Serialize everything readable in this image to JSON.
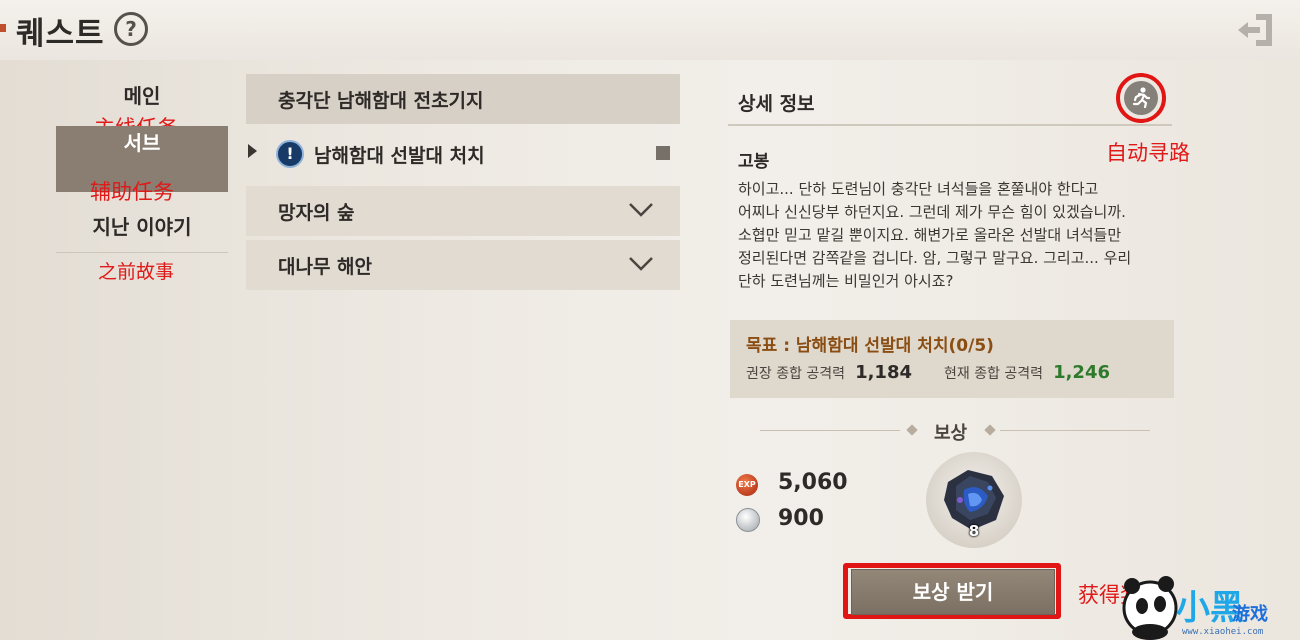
{
  "header": {
    "title": "퀘스트",
    "help_glyph": "?",
    "icons": [
      "help-icon",
      "exit-icon"
    ]
  },
  "nav": {
    "items": [
      {
        "label": "메인",
        "annotation": "主线任务"
      },
      {
        "label": "서브",
        "annotation": "辅助任务",
        "selected": true
      },
      {
        "label": "지난 이야기",
        "annotation": "之前故事"
      }
    ]
  },
  "quest_list": {
    "groups": [
      {
        "label": "충각단 남해함대 전초기지",
        "expanded": true,
        "quests": [
          {
            "badge": "!",
            "name": "남해함대 선발대 처치"
          }
        ]
      },
      {
        "label": "망자의 숲",
        "expanded": false
      },
      {
        "label": "대나무 해안",
        "expanded": false
      }
    ]
  },
  "detail": {
    "title": "상세 정보",
    "autopath_annotation": "自动寻路",
    "npc": "고봉",
    "dialog_lines": [
      "하이고... 단하 도련님이 충각단 녀석들을 혼쭐내야 한다고",
      "어찌나 신신당부 하던지요. 그런데 제가 무슨 힘이 있겠습니까.",
      "소협만 믿고 맡길 뿐이지요. 해변가로 올라온 선발대 녀석들만",
      "정리된다면 감쪽같을 겁니다. 암, 그렇구 말구요. 그리고... 우리",
      "단하 도련님께는 비밀인거 아시죠?"
    ],
    "objective": "목표 : 남해함대 선발대 처치(0/5)",
    "recommended_power_label": "권장 종합 공격력",
    "recommended_power": "1,184",
    "current_power_label": "현재 종합 공격력",
    "current_power": "1,246",
    "current_power_color": "#2d7a2b"
  },
  "reward": {
    "title": "보상",
    "exp_label": "EXP",
    "exp": "5,060",
    "silver": "900",
    "item_count": "8",
    "claim_label": "보상 받기",
    "claim_annotation": "获得奖励"
  },
  "watermark": {
    "logo": "小黑",
    "logo_sub": "游戏",
    "url": "www.xiaohei.com"
  },
  "colors": {
    "annotation": "#e21515",
    "selected_nav_bg": "#8a7e72",
    "objective_text": "#8a4d12"
  }
}
